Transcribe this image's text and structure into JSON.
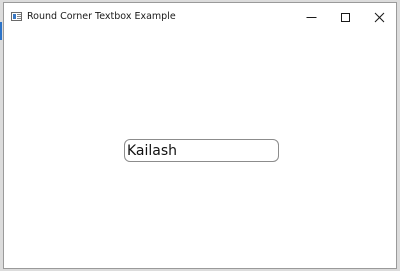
{
  "window": {
    "title": "Round Corner Textbox Example"
  },
  "controls": {
    "minimize_icon": "minimize-icon",
    "maximize_icon": "maximize-icon",
    "close_icon": "close-icon"
  },
  "textbox": {
    "value": "Kailash"
  }
}
